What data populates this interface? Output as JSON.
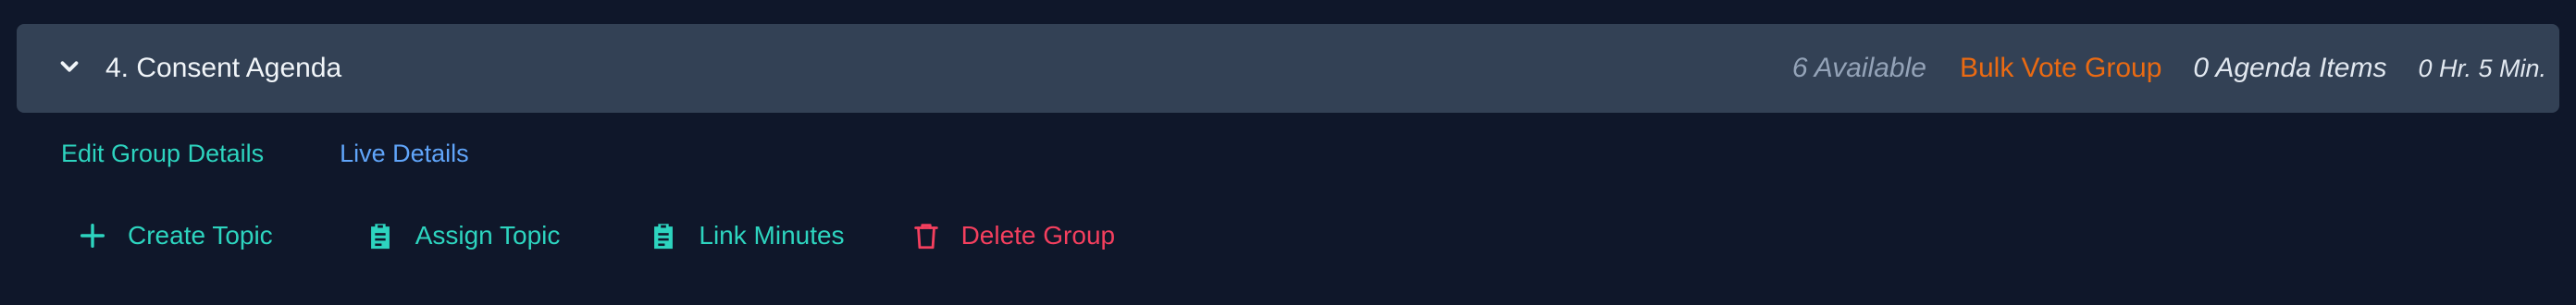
{
  "group": {
    "title": "4. Consent Agenda",
    "available": "6 Available",
    "bulk_vote": "Bulk Vote Group",
    "agenda_items": "0 Agenda Items",
    "duration": "0 Hr. 5 Min."
  },
  "links": {
    "edit": "Edit Group Details",
    "live": "Live Details"
  },
  "actions": {
    "create": "Create Topic",
    "assign": "Assign Topic",
    "link_minutes": "Link Minutes",
    "delete": "Delete Group"
  },
  "icons": {
    "collapse": "chevron-down-icon",
    "create": "plus-icon",
    "assign": "clipboard-icon",
    "link_minutes": "clipboard-icon",
    "delete": "trash-icon"
  },
  "colors": {
    "background": "#0f172a",
    "header": "#334155",
    "teal": "#2dd4bf",
    "blue": "#60a5fa",
    "orange": "#ea6a12",
    "red": "#f43f5e",
    "muted": "#94a3b8"
  }
}
